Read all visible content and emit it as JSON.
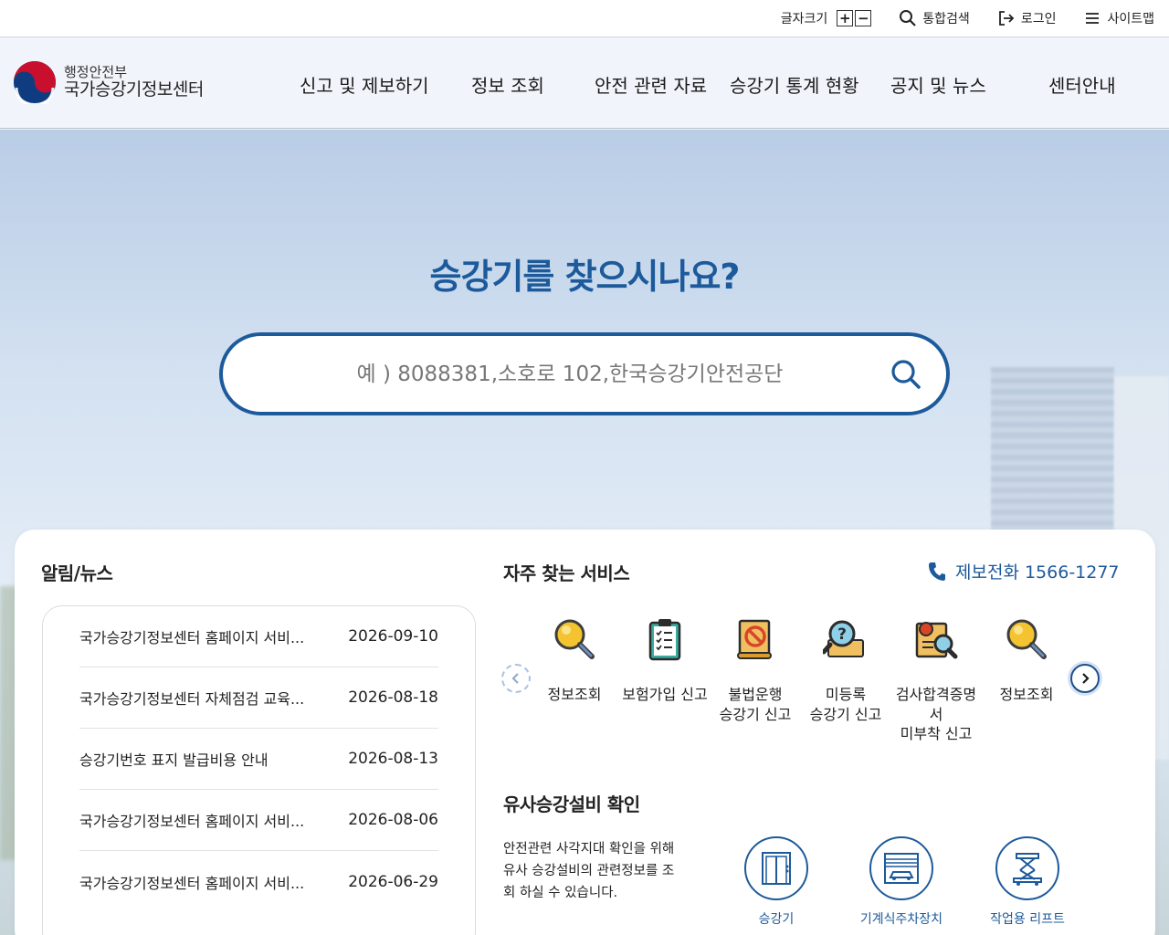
{
  "util": {
    "font_size_label": "글자크기",
    "plus": "+",
    "minus": "−",
    "search_label": "통합검색",
    "login_label": "로그인",
    "sitemap_label": "사이트맵"
  },
  "logo": {
    "sub": "행정안전부",
    "main": "국가승강기정보센터"
  },
  "gnb": [
    "신고 및 제보하기",
    "정보 조회",
    "안전 관련 자료",
    "승강기 통계 현황",
    "공지 및 뉴스",
    "센터안내"
  ],
  "hero": {
    "title": "승강기를 찾으시나요?",
    "search_placeholder": "예 ) 8088381,소호로 102,한국승강기안전공단"
  },
  "news": {
    "title": "알림/뉴스",
    "items": [
      {
        "title": "국가승강기정보센터 홈페이지 서비...",
        "date": "2026-09-10"
      },
      {
        "title": "국가승강기정보센터 자체점검 교육...",
        "date": "2026-08-18"
      },
      {
        "title": "승강기번호 표지 발급비용 안내",
        "date": "2026-08-13"
      },
      {
        "title": "국가승강기정보센터 홈페이지 서비...",
        "date": "2026-08-06"
      },
      {
        "title": "국가승강기정보센터 홈페이지 서비...",
        "date": "2026-06-29"
      }
    ]
  },
  "services": {
    "title": "자주 찾는 서비스",
    "phone_label": "제보전화 1566-1277",
    "items": [
      {
        "label": "정보조회",
        "icon": "magnifier-icon"
      },
      {
        "label": "보험가입 신고",
        "icon": "clipboard-icon"
      },
      {
        "label": "불법운행\n승강기 신고",
        "icon": "prohibited-document-icon"
      },
      {
        "label": "미등록\n승강기 신고",
        "icon": "question-magnifier-icon"
      },
      {
        "label": "검사합격증명\n서\n미부착 신고",
        "icon": "certificate-icon"
      },
      {
        "label": "정보조회",
        "icon": "magnifier-icon"
      }
    ]
  },
  "similar": {
    "title": "유사승강설비 확인",
    "desc": "안전관련 사각지대 확인을 위해 유사 승강설비의 관련정보를 조회 하실 수 있습니다.",
    "items": [
      {
        "label": "승강기",
        "icon": "elevator-icon"
      },
      {
        "label": "기계식주차장치",
        "icon": "parking-icon"
      },
      {
        "label": "작업용 리프트",
        "icon": "lift-icon"
      }
    ]
  },
  "colors": {
    "brand": "#1d5a9b",
    "accent_red": "#c8102e"
  }
}
